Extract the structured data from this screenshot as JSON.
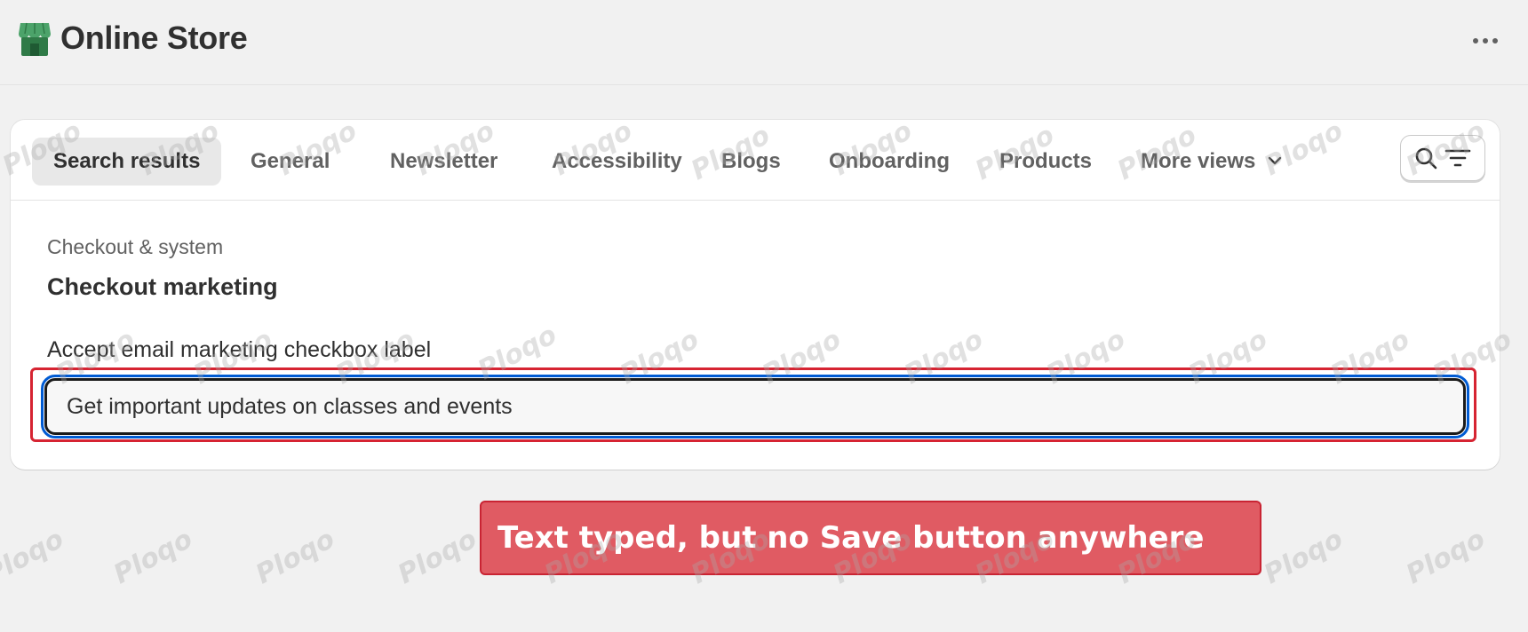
{
  "header": {
    "title": "Online Store",
    "store_icon": "storefront-icon",
    "more_actions_icon": "horizontal-dots-icon"
  },
  "tabs": [
    {
      "label": "Search results",
      "active": true
    },
    {
      "label": "General",
      "active": false
    },
    {
      "label": "Newsletter",
      "active": false
    },
    {
      "label": "Accessibility",
      "active": false
    },
    {
      "label": "Blogs",
      "active": false
    },
    {
      "label": "Onboarding",
      "active": false
    },
    {
      "label": "Products",
      "active": false
    },
    {
      "label": "More views",
      "active": false
    }
  ],
  "toolbar": {
    "search_icon": "search-icon",
    "filter_icon": "filter-lines-icon"
  },
  "section": {
    "subtitle": "Checkout & system",
    "title": "Checkout marketing"
  },
  "field": {
    "label": "Accept email marketing checkbox label",
    "value": "Get important updates on classes and events"
  },
  "annotation": {
    "text": "Text typed, but no Save button anywhere"
  },
  "watermark_text": "Ploqo",
  "colors": {
    "brand_green": "#4ca36a",
    "focus_blue": "#005bd3",
    "highlight_red": "#d62432",
    "banner_fill": "#e05b63"
  }
}
